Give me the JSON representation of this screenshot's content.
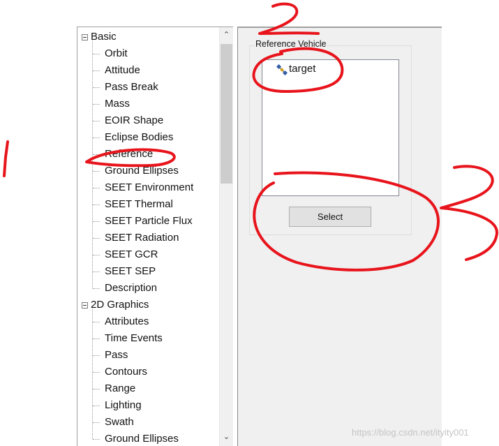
{
  "tree": {
    "groups": [
      {
        "label": "Basic",
        "items": [
          "Orbit",
          "Attitude",
          "Pass Break",
          "Mass",
          "EOIR Shape",
          "Eclipse Bodies",
          "Reference",
          "Ground Ellipses",
          "SEET Environment",
          "SEET Thermal",
          "SEET Particle Flux",
          "SEET Radiation",
          "SEET GCR",
          "SEET SEP",
          "Description"
        ]
      },
      {
        "label": "2D Graphics",
        "items": [
          "Attributes",
          "Time Events",
          "Pass",
          "Contours",
          "Range",
          "Lighting",
          "Swath",
          "Ground Ellipses"
        ]
      }
    ],
    "selected_item": "Reference"
  },
  "scrollbar": {
    "up_glyph": "⌃",
    "down_glyph": "⌄"
  },
  "reference_vehicle": {
    "title": "Reference Vehicle",
    "items": [
      {
        "name": "target",
        "icon": "satellite-icon"
      }
    ],
    "select_label": "Select"
  },
  "annotations": {
    "color": "#e8141c",
    "numbers": [
      "1",
      "2",
      "3"
    ]
  },
  "watermark": "https://blog.csdn.net/ityity001"
}
